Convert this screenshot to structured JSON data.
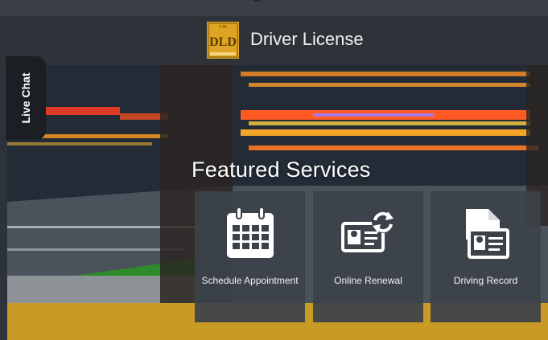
{
  "header": {
    "title": "Driver License",
    "logo_text": "DLD"
  },
  "live_chat": {
    "label": "Live Chat"
  },
  "hero": {
    "heading": "Featured Services"
  },
  "services": [
    {
      "label": "Schedule Appointment",
      "icon": "calendar-icon"
    },
    {
      "label": "Online Renewal",
      "icon": "license-renewal-icon"
    },
    {
      "label": "Driving Record",
      "icon": "driving-record-icon"
    }
  ],
  "colors": {
    "header_bg": "#2f3339",
    "tile_bg": "#3c424a",
    "gold_band": "#c99a24",
    "logo_gold": "#e0a424"
  }
}
